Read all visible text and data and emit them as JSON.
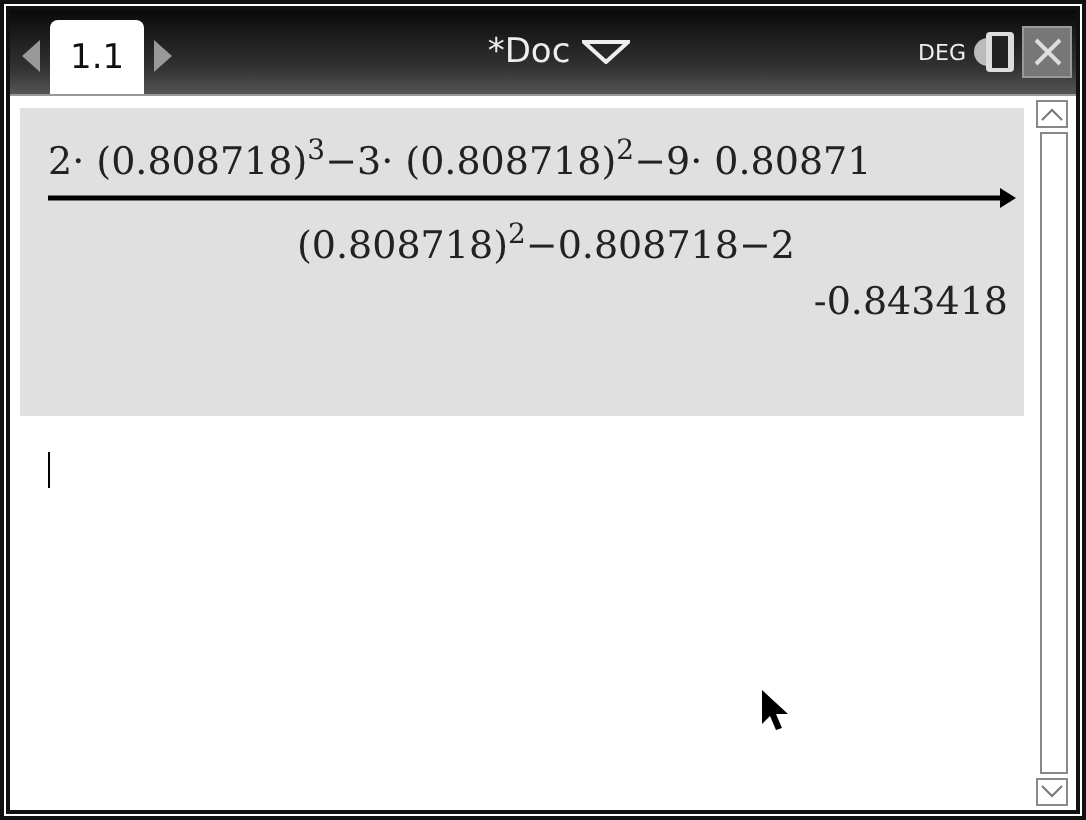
{
  "tab": {
    "label": "1.1",
    "selected": true
  },
  "document": {
    "title": "*Doc"
  },
  "angle_mode": "DEG",
  "entry": {
    "numerator": "2· (0.808718)$^{3}$−3· (0.808718)$^{2}$−9· 0.80871",
    "denominator": "(0.808718)$^{2}$−0.808718−2",
    "result": "-0.843418"
  }
}
